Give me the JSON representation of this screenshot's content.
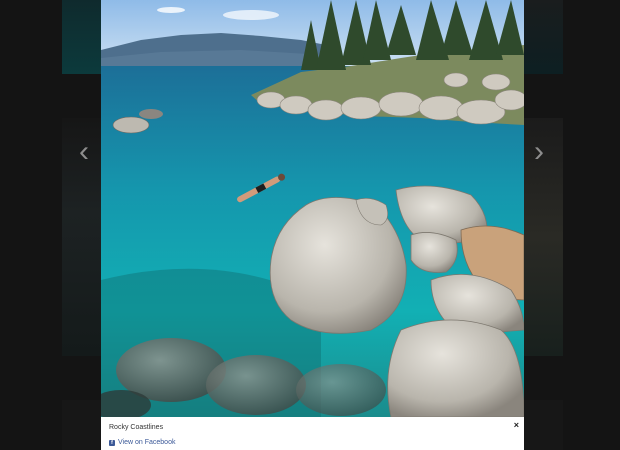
{
  "lightbox": {
    "caption": "Rocky Coastlines",
    "facebook_link": "View on Facebook",
    "close_glyph": "×"
  },
  "navigation": {
    "prev_glyph": "‹",
    "next_glyph": "›"
  },
  "icons": {
    "facebook": "facebook-icon",
    "close": "close-icon",
    "prev": "chevron-left-icon",
    "next": "chevron-right-icon"
  },
  "colors": {
    "overlay": "#0d0d0d",
    "link": "#3b5998",
    "water": "#1aa7b3"
  }
}
